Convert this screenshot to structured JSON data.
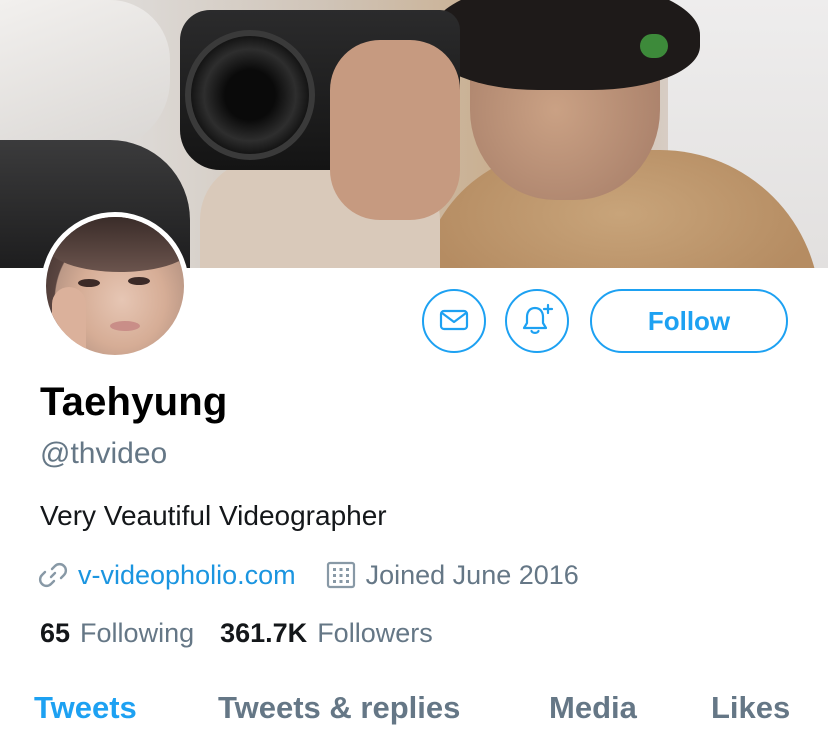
{
  "profile": {
    "display_name": "Taehyung",
    "handle": "@thvideo",
    "bio": "Very Veautiful Videographer",
    "website": "v-videopholio.com",
    "joined": "Joined June 2016"
  },
  "stats": {
    "following_count": "65",
    "following_label": "Following",
    "followers_count": "361.7K",
    "followers_label": "Followers"
  },
  "actions": {
    "follow_label": "Follow",
    "message_icon": "mail-icon",
    "notify_icon": "bell-plus-icon"
  },
  "tabs": [
    {
      "label": "Tweets",
      "active": true
    },
    {
      "label": "Tweets & replies",
      "active": false
    },
    {
      "label": "Media",
      "active": false
    },
    {
      "label": "Likes",
      "active": false
    }
  ],
  "colors": {
    "accent": "#1da1f2",
    "link": "#1b95e0",
    "secondary_text": "#657786",
    "primary_text": "#14171a"
  }
}
